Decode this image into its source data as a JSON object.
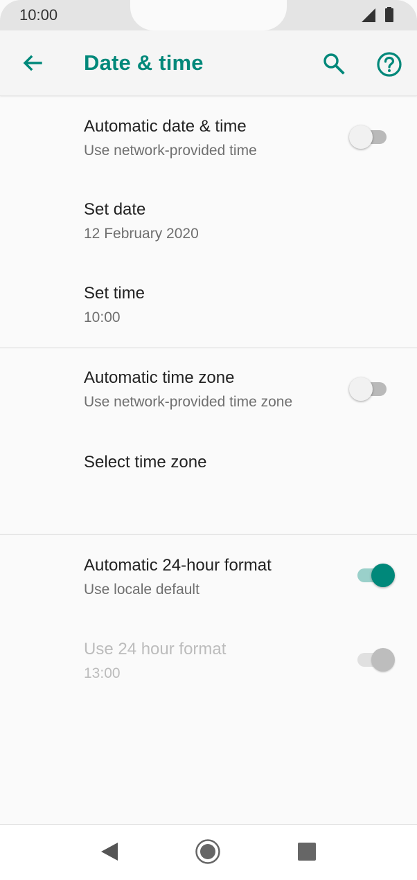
{
  "status_bar": {
    "time": "10:00"
  },
  "app_bar": {
    "title": "Date & time",
    "back_icon": "arrow-back-icon",
    "search_icon": "search-icon",
    "help_icon": "help-circle-icon",
    "accent_color": "#00887a"
  },
  "settings": {
    "auto_date_time": {
      "title": "Automatic date & time",
      "summary": "Use network-provided time",
      "enabled": false
    },
    "set_date": {
      "title": "Set date",
      "summary": "12 February 2020"
    },
    "set_time": {
      "title": "Set time",
      "summary": "10:00"
    },
    "auto_time_zone": {
      "title": "Automatic time zone",
      "summary": "Use network-provided time zone",
      "enabled": false
    },
    "select_time_zone": {
      "title": "Select time zone"
    },
    "auto_24_hour": {
      "title": "Automatic 24-hour format",
      "summary": "Use locale default",
      "enabled": true
    },
    "use_24_hour": {
      "title": "Use 24 hour format",
      "summary": "13:00",
      "enabled": true,
      "disabled": true
    }
  },
  "nav_bar": {
    "back_icon": "nav-back-triangle-icon",
    "home_icon": "nav-home-circle-icon",
    "recents_icon": "nav-recents-square-icon"
  }
}
